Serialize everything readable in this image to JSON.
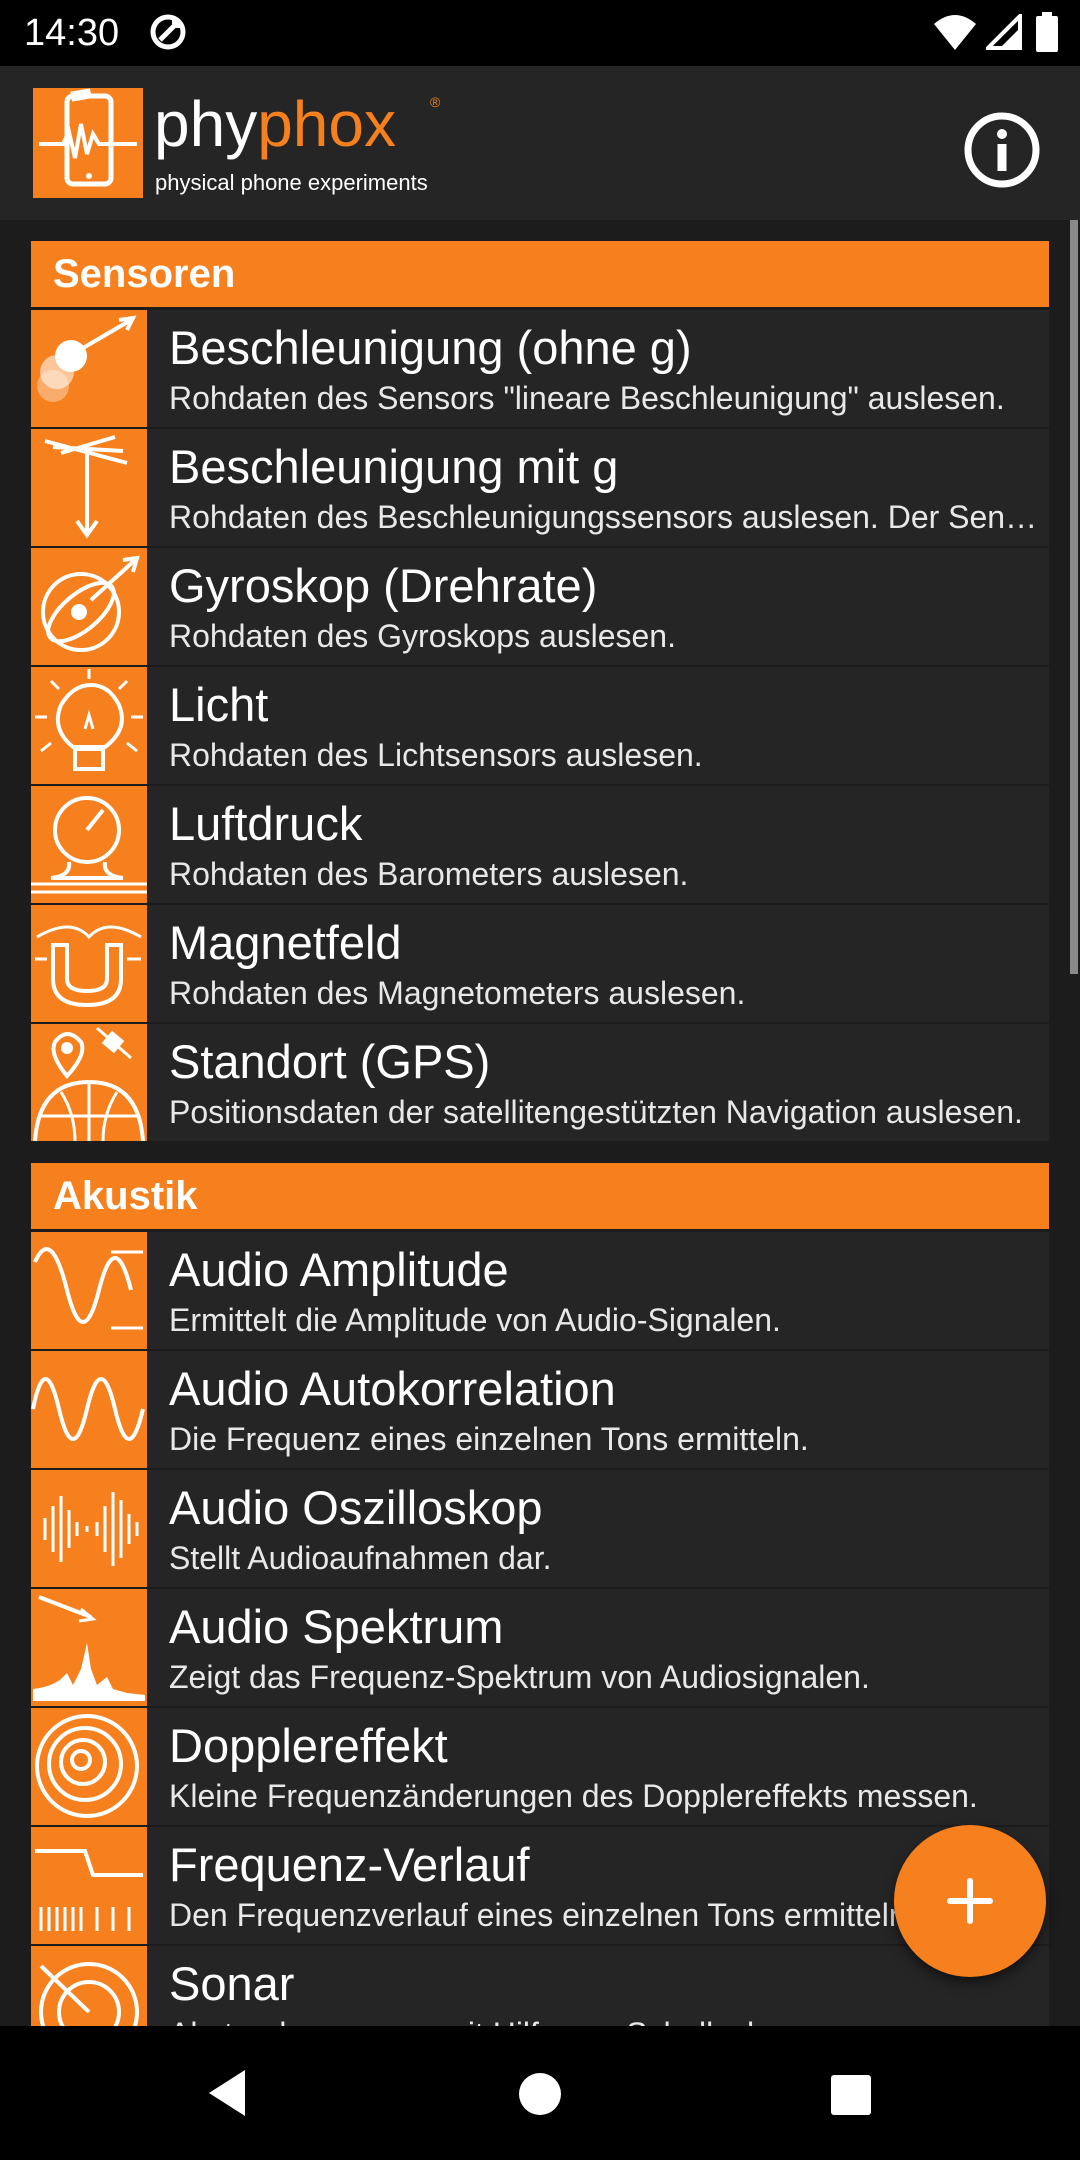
{
  "status_bar": {
    "time": "14:30"
  },
  "app_bar": {
    "logo_part1": "phy",
    "logo_part2": "phox",
    "logo_reg": "®",
    "tagline": "physical phone experiments"
  },
  "sections": [
    {
      "title": "Sensoren",
      "items": [
        {
          "title": "Beschleunigung (ohne g)",
          "desc": "Rohdaten des Sensors \"lineare Beschleunigung\" auslesen.",
          "icon": "acceleration-icon"
        },
        {
          "title": "Beschleunigung mit g",
          "desc": "Rohdaten des Beschleunigungssensors auslesen. Der Sensor misst auch die Erdbeschleunigung.",
          "icon": "acceleration-g-icon"
        },
        {
          "title": "Gyroskop (Drehrate)",
          "desc": "Rohdaten des Gyroskops auslesen.",
          "icon": "gyroscope-icon"
        },
        {
          "title": "Licht",
          "desc": "Rohdaten des Lichtsensors auslesen.",
          "icon": "light-bulb-icon"
        },
        {
          "title": "Luftdruck",
          "desc": "Rohdaten des Barometers auslesen.",
          "icon": "barometer-icon"
        },
        {
          "title": "Magnetfeld",
          "desc": "Rohdaten des Magnetometers auslesen.",
          "icon": "magnet-icon"
        },
        {
          "title": "Standort (GPS)",
          "desc": "Positionsdaten der satellitengestützten Navigation auslesen.",
          "icon": "gps-globe-icon"
        }
      ]
    },
    {
      "title": "Akustik",
      "items": [
        {
          "title": "Audio Amplitude",
          "desc": "Ermittelt die Amplitude von Audio-Signalen.",
          "icon": "amplitude-wave-icon"
        },
        {
          "title": "Audio Autokorrelation",
          "desc": "Die Frequenz eines einzelnen Tons ermitteln.",
          "icon": "autocorrelation-wave-icon"
        },
        {
          "title": "Audio Oszilloskop",
          "desc": "Stellt Audioaufnahmen dar.",
          "icon": "oscilloscope-icon"
        },
        {
          "title": "Audio Spektrum",
          "desc": "Zeigt das Frequenz-Spektrum von Audiosignalen.",
          "icon": "spectrum-icon"
        },
        {
          "title": "Dopplereffekt",
          "desc": "Kleine Frequenzänderungen des Dopplereffekts messen.",
          "icon": "doppler-rings-icon"
        },
        {
          "title": "Frequenz-Verlauf",
          "desc": "Den Frequenzverlauf eines einzelnen Tons ermitteln.",
          "icon": "frequency-history-icon"
        },
        {
          "title": "Sonar",
          "desc": "Abstandsmessung mit Hilfe von Schallechos.",
          "icon": "sonar-icon"
        }
      ]
    }
  ],
  "colors": {
    "accent": "#f7801e",
    "item_bg": "#252525",
    "page_bg": "#1c1c1c"
  }
}
